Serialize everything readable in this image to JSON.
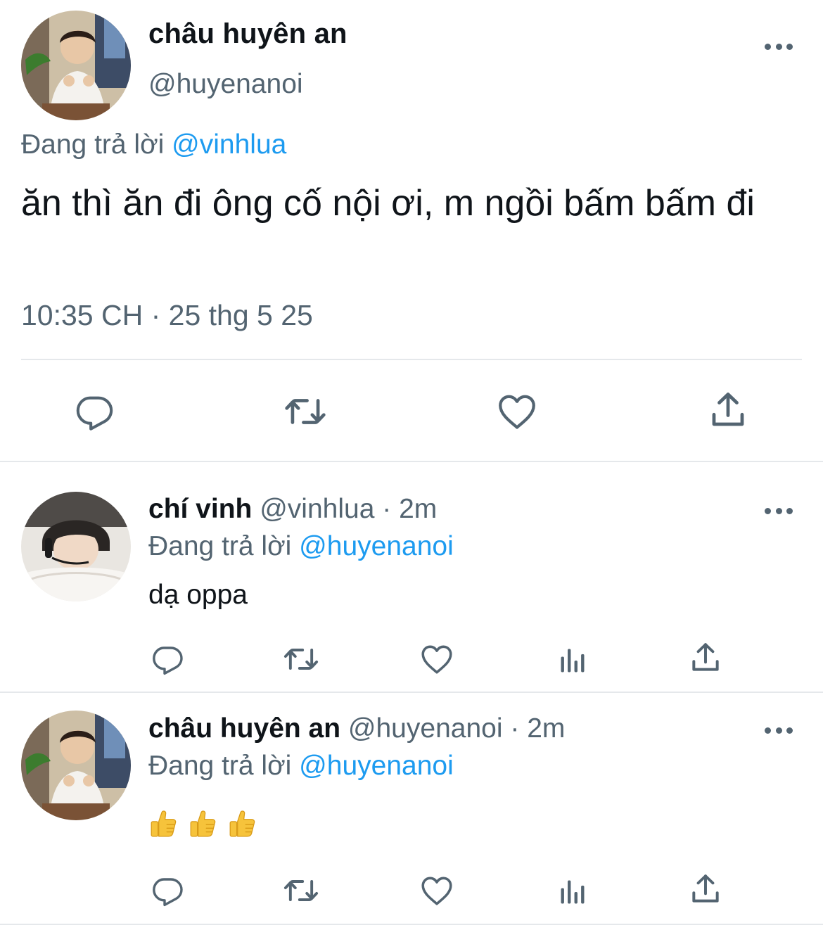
{
  "main_tweet": {
    "display_name": "châu huyên an",
    "handle": "@huyenanoi",
    "replying_prefix": "Đang trả lời",
    "replying_to": "@vinhlua",
    "text": "ăn thì ăn đi ông cố nội ơi, m ngồi bấm bấm đi",
    "timestamp": "10:35 CH · 25 thg 5 25",
    "actions": [
      "reply-icon",
      "retweet-icon",
      "like-icon",
      "share-icon"
    ]
  },
  "replies": [
    {
      "display_name": "chí vinh",
      "handle": "@vinhlua",
      "separator": "·",
      "time": "2m",
      "replying_prefix": "Đang trả lời",
      "replying_to": "@huyenanoi",
      "text": "dạ oppa",
      "actions": [
        "reply-icon",
        "retweet-icon",
        "like-icon",
        "analytics-icon",
        "share-icon"
      ]
    },
    {
      "display_name": "châu huyên an",
      "handle": "@huyenanoi",
      "separator": "·",
      "time": "2m",
      "replying_prefix": "Đang trả lời",
      "replying_to": "@huyenanoi",
      "emojis": [
        "👍",
        "👍",
        "👍"
      ],
      "actions": [
        "reply-icon",
        "retweet-icon",
        "like-icon",
        "analytics-icon",
        "share-icon"
      ]
    }
  ],
  "colors": {
    "text_primary": "#0f1419",
    "text_secondary": "#536471",
    "accent_blue": "#1d9bf0",
    "divider": "#e5e8eb"
  }
}
